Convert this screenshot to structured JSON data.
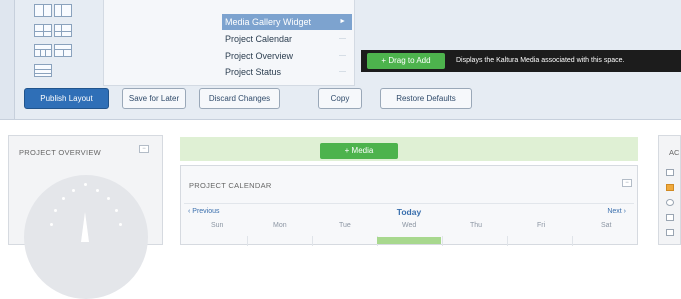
{
  "widgets": {
    "items": [
      {
        "label": "Media Gallery Widget",
        "selected": true
      },
      {
        "label": "Project Calendar",
        "selected": false
      },
      {
        "label": "Project Overview",
        "selected": false
      },
      {
        "label": "Project Status",
        "selected": false
      }
    ]
  },
  "tooltip": {
    "button_label": "+ Drag to Add",
    "text": "Displays the Kaltura Media associated with this space."
  },
  "toolbar": {
    "publish_label": "Publish Layout",
    "save_label": "Save for Later",
    "discard_label": "Discard Changes",
    "copy_label": "Copy",
    "restore_label": "Restore Defaults"
  },
  "overview": {
    "title": "PROJECT OVERVIEW"
  },
  "drop": {
    "label": "+ Media"
  },
  "calendar": {
    "title": "PROJECT CALENDAR",
    "prev": "‹ Previous",
    "today": "Today",
    "next": "Next ›",
    "days": [
      "Sun",
      "Mon",
      "Tue",
      "Wed",
      "Thu",
      "Fri",
      "Sat"
    ]
  },
  "right": {
    "title": "AC"
  },
  "colors": {
    "accent": "#2f6fb7",
    "add_green": "#4db34d"
  }
}
